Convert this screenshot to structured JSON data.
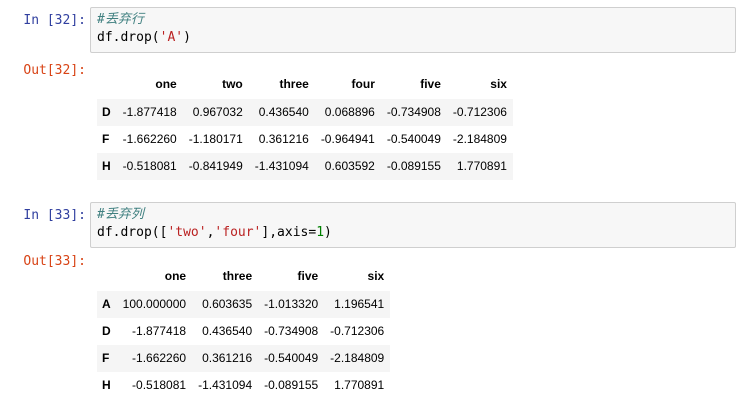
{
  "cell1": {
    "in_prompt": "In [32]:",
    "comment": "#丢弃行",
    "code_prefix": "df.drop(",
    "code_str": "'A'",
    "code_suffix": ")",
    "out_prompt": "Out[32]:",
    "table": {
      "columns": [
        "one",
        "two",
        "three",
        "four",
        "five",
        "six"
      ],
      "rows": [
        {
          "index": "D",
          "values": [
            "-1.877418",
            "0.967032",
            "0.436540",
            "0.068896",
            "-0.734908",
            "-0.712306"
          ]
        },
        {
          "index": "F",
          "values": [
            "-1.662260",
            "-1.180171",
            "0.361216",
            "-0.964941",
            "-0.540049",
            "-2.184809"
          ]
        },
        {
          "index": "H",
          "values": [
            "-0.518081",
            "-0.841949",
            "-1.431094",
            "0.603592",
            "-0.089155",
            "1.770891"
          ]
        }
      ]
    }
  },
  "cell2": {
    "in_prompt": "In [33]:",
    "comment": "#丢弃列",
    "code_prefix": "df.drop([",
    "code_str1": "'two'",
    "code_comma": ",",
    "code_str2": "'four'",
    "code_mid": "],axis=",
    "code_num": "1",
    "code_suffix": ")",
    "out_prompt": "Out[33]:",
    "table": {
      "columns": [
        "one",
        "three",
        "five",
        "six"
      ],
      "rows": [
        {
          "index": "A",
          "values": [
            "100.000000",
            "0.603635",
            "-1.013320",
            "1.196541"
          ]
        },
        {
          "index": "D",
          "values": [
            "-1.877418",
            "0.436540",
            "-0.734908",
            "-0.712306"
          ]
        },
        {
          "index": "F",
          "values": [
            "-1.662260",
            "0.361216",
            "-0.540049",
            "-2.184809"
          ]
        },
        {
          "index": "H",
          "values": [
            "-0.518081",
            "-1.431094",
            "-0.089155",
            "1.770891"
          ]
        }
      ]
    }
  }
}
